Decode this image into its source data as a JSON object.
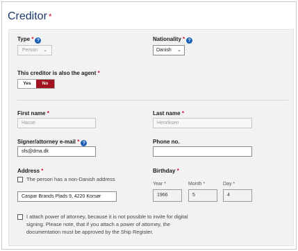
{
  "title": "Creditor",
  "required_mark": "*",
  "type": {
    "label": "Type",
    "help_icon": "question-circle-icon",
    "value": "Person",
    "chevron_icon": "chevron-down-icon"
  },
  "nationality": {
    "label": "Nationality",
    "help_icon": "question-circle-icon",
    "value": "Danish",
    "chevron_icon": "chevron-down-icon"
  },
  "agent": {
    "label": "This creditor is also the agent",
    "options": [
      "Yes",
      "No"
    ],
    "selected": "No",
    "accent": "#a3131f"
  },
  "first_name": {
    "label": "First name",
    "value": "Hasse"
  },
  "last_name": {
    "label": "Last name",
    "value": "Henriksen"
  },
  "email": {
    "label": "Signer/attorney e-mail",
    "help_icon": "question-circle-icon",
    "value": "sfs@dma.dk"
  },
  "phone": {
    "label": "Phone no.",
    "value": ""
  },
  "address": {
    "label": "Address",
    "non_danish_label": "The person has a non-Danish address",
    "non_danish_checked": false,
    "value": "Caspar Brands Plads 9, 4220 Korsør"
  },
  "birthday": {
    "label": "Birthday",
    "year_label": "Year",
    "month_label": "Month",
    "day_label": "Day",
    "year": "1966",
    "month": "5",
    "day": "4"
  },
  "power_of_attorney": {
    "checked": false,
    "text_line1": "I attach power of attorney, because it is not possible to invite for digital",
    "text_line2": "signing. Please note, that if you attach a power of attorney, the",
    "text_line3": "documentation must be approved by the Ship Register."
  },
  "colors": {
    "title": "#1a3a6e",
    "required": "#c8102e",
    "help": "#1a5fb4",
    "panel": "#f2f2f2"
  }
}
